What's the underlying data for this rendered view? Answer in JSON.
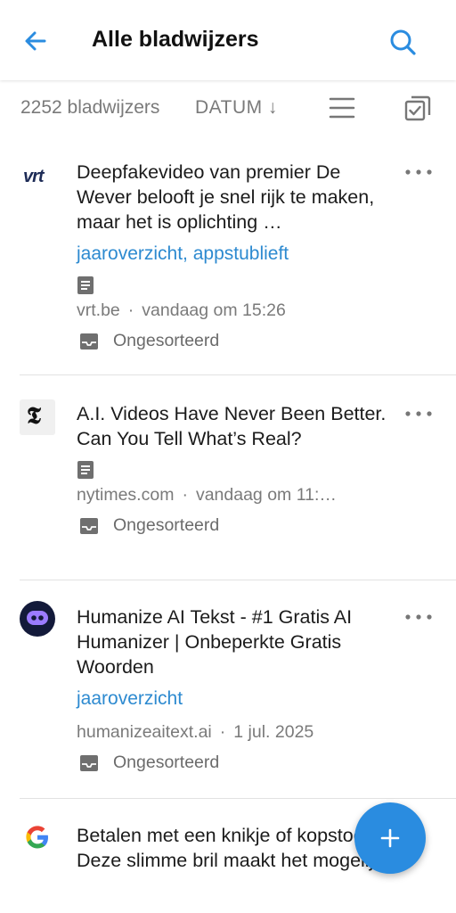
{
  "header": {
    "title": "Alle bladwijzers",
    "back_icon": "arrow-left-icon",
    "search_icon": "search-icon"
  },
  "toolbar": {
    "count": "2252 bladwijzers",
    "sort": "DATUM ↓",
    "list_icon": "list-view-icon",
    "select_icon": "select-all-icon"
  },
  "colors": {
    "accent": "#2a8ce0",
    "tag": "#2d8ad0",
    "muted": "#7a7a7a"
  },
  "items": [
    {
      "logo": "vrt-logo",
      "logo_text": "vrt",
      "headline": "Deepfakevideo van premier De Wever belooft je snel rijk te maken, maar het is oplichting …",
      "tags": "jaaroverzicht, appstublieft",
      "domain": "vrt.be",
      "time": "vandaag om 15:26",
      "collection": "Ongesorteerd"
    },
    {
      "logo": "nytimes-logo",
      "logo_text": "𝕿",
      "headline": "A.I. Videos Have Never Been Better. Can You Tell What’s Real?",
      "tags": "",
      "domain": "nytimes.com",
      "time": "vandaag om 11:…",
      "collection": "Ongesorteerd"
    },
    {
      "logo": "humanize-logo",
      "logo_text": "",
      "headline": "Humanize AI Tekst - #1 Gratis AI Humanizer | Onbeperkte Gratis Woorden",
      "tags": "jaaroverzicht",
      "domain": "humanizeaitext.ai",
      "time": "1 jul. 2025",
      "collection": "Ongesorteerd"
    },
    {
      "logo": "google-logo",
      "logo_text": "G",
      "headline": "Betalen met een knikje of kopstoot? Deze slimme bril maakt het mogelijk",
      "tags": "",
      "domain": "",
      "time": "",
      "collection": ""
    }
  ],
  "fab": {
    "icon": "plus-icon"
  }
}
